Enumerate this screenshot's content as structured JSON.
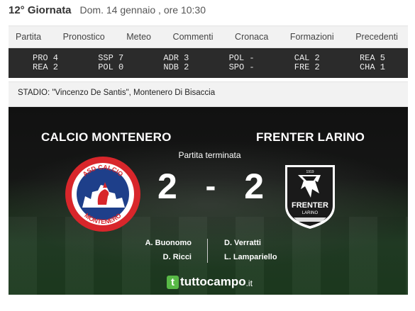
{
  "header": {
    "round": "12° Giornata",
    "datetime": "Dom. 14 gennaio , ore 10:30"
  },
  "tabs": [
    {
      "label": "Partita"
    },
    {
      "label": "Pronostico"
    },
    {
      "label": "Meteo"
    },
    {
      "label": "Commenti"
    },
    {
      "label": "Cronaca"
    },
    {
      "label": "Formazioni"
    },
    {
      "label": "Precedenti"
    }
  ],
  "other_results": [
    {
      "line1": "PRO 4",
      "line2": "REA 2"
    },
    {
      "line1": "SSP 7",
      "line2": "POL 0"
    },
    {
      "line1": "ADR 3",
      "line2": "NDB 2"
    },
    {
      "line1": "POL -",
      "line2": "SPO -"
    },
    {
      "line1": "CAL 2",
      "line2": "FRE 2"
    },
    {
      "line1": "REA 5",
      "line2": "CHA 1"
    }
  ],
  "stadium": "STADIO: \"Vincenzo De Santis\", Montenero Di Bisaccia",
  "match": {
    "home_team": "CALCIO MONTENERO",
    "away_team": "FRENTER LARINO",
    "status": "Partita terminata",
    "home_score": "2",
    "away_score": "2",
    "separator": "-",
    "home_scorers": [
      "A. Buonomo",
      "D. Ricci"
    ],
    "away_scorers": [
      "D. Verratti",
      "L. Lampariello"
    ],
    "home_logo_text_top": "ASD CALCIO",
    "home_logo_text_bottom": "MONTENERO",
    "away_logo_text": "FRENTER",
    "away_logo_subtext": "LARINO",
    "away_logo_year": "1919"
  },
  "brand": {
    "badge": "t",
    "name": "tuttocampo",
    "tld": ".it"
  },
  "colors": {
    "tab_bar": "#f2f2f2",
    "results_bar": "#2b2b2b",
    "brand_green": "#58b946",
    "home_red": "#d8262b",
    "home_blue": "#1e3f8a"
  }
}
